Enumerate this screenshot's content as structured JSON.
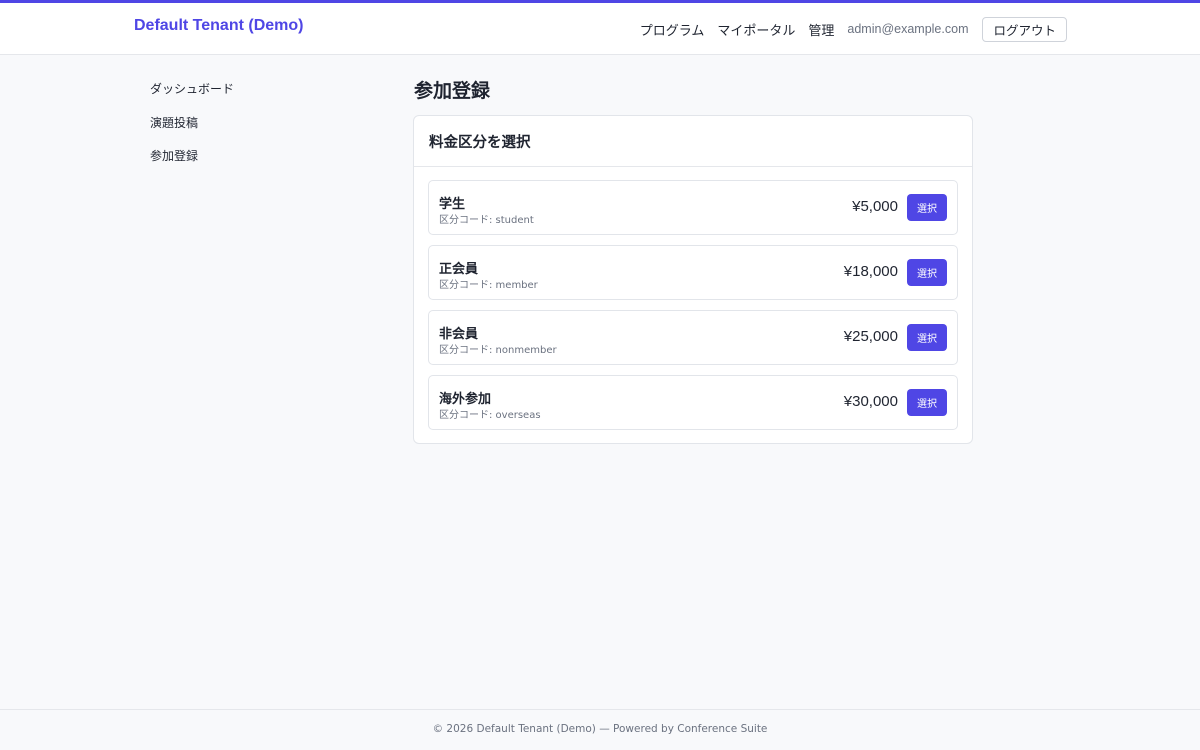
{
  "header": {
    "brand": "Default Tenant (Demo)",
    "nav": {
      "program": "プログラム",
      "my_portal": "マイポータル",
      "admin": "管理"
    },
    "user_email": "admin@example.com",
    "logout_label": "ログアウト"
  },
  "sidebar": {
    "items": [
      {
        "label": "ダッシュボード"
      },
      {
        "label": "演題投稿"
      },
      {
        "label": "参加登録"
      }
    ]
  },
  "main": {
    "title": "参加登録",
    "panel_title": "料金区分を選択",
    "plans": [
      {
        "name": "学生",
        "code": "区分コード: student",
        "price": "¥5,000",
        "button": "選択"
      },
      {
        "name": "正会員",
        "code": "区分コード: member",
        "price": "¥18,000",
        "button": "選択"
      },
      {
        "name": "非会員",
        "code": "区分コード: nonmember",
        "price": "¥25,000",
        "button": "選択"
      },
      {
        "name": "海外参加",
        "code": "区分コード: overseas",
        "price": "¥30,000",
        "button": "選択"
      }
    ]
  },
  "footer": {
    "text": "© 2026 Default Tenant (Demo) — Powered by Conference Suite"
  },
  "colors": {
    "accent": "#4f46e5",
    "background": "#f8f9fb"
  }
}
